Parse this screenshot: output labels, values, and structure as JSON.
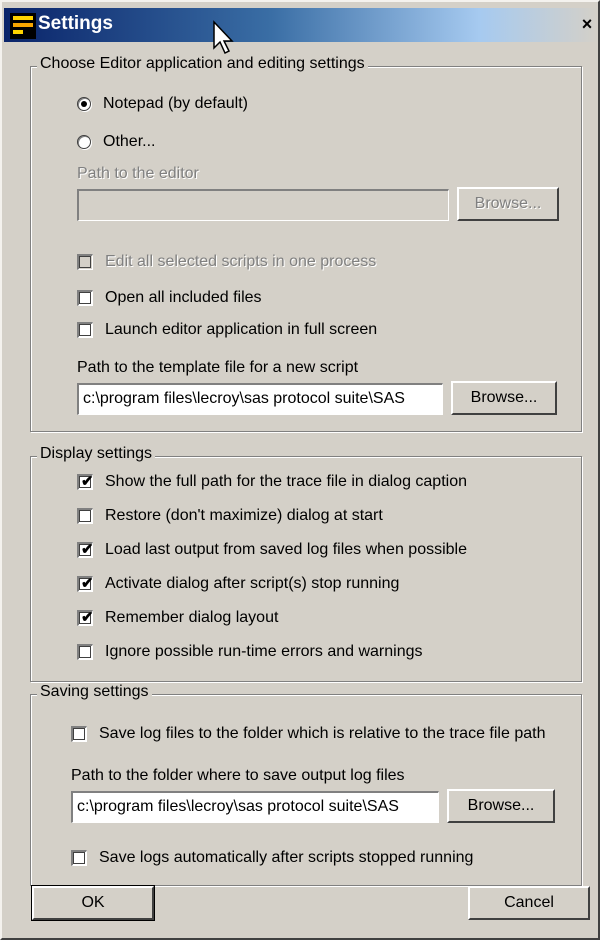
{
  "window": {
    "title": "Settings",
    "close_label": "×"
  },
  "editor": {
    "group_title": "Choose Editor application and editing settings",
    "radio_notepad": "Notepad (by default)",
    "radio_other": "Other...",
    "path_label": "Path to the editor",
    "path_value": "",
    "browse_label": "Browse...",
    "edit_all_label": "Edit all selected scripts in one process",
    "open_included_label": "Open all included files",
    "fullscreen_label": "Launch editor application in full screen",
    "template_label": "Path to the template file for a new script",
    "template_value": "c:\\program files\\lecroy\\sas protocol suite\\SAS",
    "template_browse_label": "Browse..."
  },
  "display": {
    "group_title": "Display settings",
    "items": [
      {
        "label": "Show the full path for the trace file in dialog caption",
        "checked": true
      },
      {
        "label": "Restore (don't maximize) dialog at start",
        "checked": false
      },
      {
        "label": "Load last output from saved log files when possible",
        "checked": true
      },
      {
        "label": "Activate dialog after script(s) stop running",
        "checked": true
      },
      {
        "label": "Remember dialog layout",
        "checked": true
      },
      {
        "label": "Ignore possible run-time errors and warnings",
        "checked": false
      }
    ]
  },
  "saving": {
    "group_title": "Saving settings",
    "relative_label": "Save log files to the folder which is relative to the trace file path",
    "folder_label": "Path to the folder where to save output log files",
    "folder_value": "c:\\program files\\lecroy\\sas protocol suite\\SAS",
    "browse_label": "Browse...",
    "auto_save_label": "Save logs automatically after scripts stopped running"
  },
  "buttons": {
    "ok": "OK",
    "cancel": "Cancel"
  },
  "check_mark": "✔"
}
